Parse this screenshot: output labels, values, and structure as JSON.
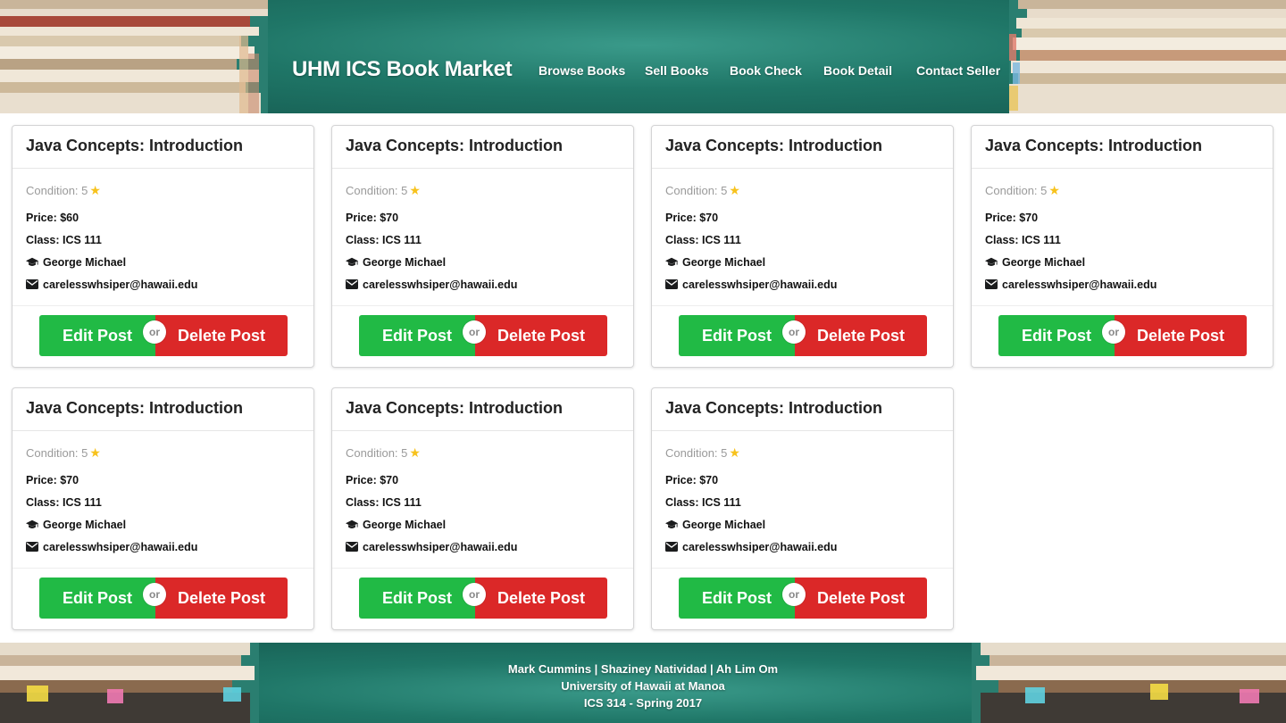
{
  "header": {
    "brand": "UHM ICS Book Market",
    "nav": [
      "Browse Books",
      "Sell Books",
      "Book Check",
      "Book Detail",
      "Contact Seller"
    ]
  },
  "cards": [
    {
      "title": "Java Concepts: Introduction",
      "condition": "Condition: 5",
      "price": "Price: $60",
      "class": "Class: ICS 111",
      "seller": "George Michael",
      "email": "carelesswhsiper@hawaii.edu",
      "edit": "Edit Post",
      "or": "or",
      "delete": "Delete Post"
    },
    {
      "title": "Java Concepts: Introduction",
      "condition": "Condition: 5",
      "price": "Price: $70",
      "class": "Class: ICS 111",
      "seller": "George Michael",
      "email": "carelesswhsiper@hawaii.edu",
      "edit": "Edit Post",
      "or": "or",
      "delete": "Delete Post"
    },
    {
      "title": "Java Concepts: Introduction",
      "condition": "Condition: 5",
      "price": "Price: $70",
      "class": "Class: ICS 111",
      "seller": "George Michael",
      "email": "carelesswhsiper@hawaii.edu",
      "edit": "Edit Post",
      "or": "or",
      "delete": "Delete Post"
    },
    {
      "title": "Java Concepts: Introduction",
      "condition": "Condition: 5",
      "price": "Price: $70",
      "class": "Class: ICS 111",
      "seller": "George Michael",
      "email": "carelesswhsiper@hawaii.edu",
      "edit": "Edit Post",
      "or": "or",
      "delete": "Delete Post"
    },
    {
      "title": "Java Concepts: Introduction",
      "condition": "Condition: 5",
      "price": "Price: $70",
      "class": "Class: ICS 111",
      "seller": "George Michael",
      "email": "carelesswhsiper@hawaii.edu",
      "edit": "Edit Post",
      "or": "or",
      "delete": "Delete Post"
    },
    {
      "title": "Java Concepts: Introduction",
      "condition": "Condition: 5",
      "price": "Price: $70",
      "class": "Class: ICS 111",
      "seller": "George Michael",
      "email": "carelesswhsiper@hawaii.edu",
      "edit": "Edit Post",
      "or": "or",
      "delete": "Delete Post"
    },
    {
      "title": "Java Concepts: Introduction",
      "condition": "Condition: 5",
      "price": "Price: $70",
      "class": "Class: ICS 111",
      "seller": "George Michael",
      "email": "carelesswhsiper@hawaii.edu",
      "edit": "Edit Post",
      "or": "or",
      "delete": "Delete Post"
    }
  ],
  "icons": {
    "condition": "star-icon",
    "seller": "graduation-cap-icon",
    "email": "envelope-icon"
  },
  "colors": {
    "edit_button": "#21ba45",
    "delete_button": "#db2828",
    "star": "#f7c21c",
    "banner": "#1f7667"
  },
  "footer": {
    "authors": "Mark Cummins | Shaziney Natividad | Ah Lim Om",
    "university": "University of Hawaii at Manoa",
    "course": "ICS 314 - Spring 2017"
  }
}
